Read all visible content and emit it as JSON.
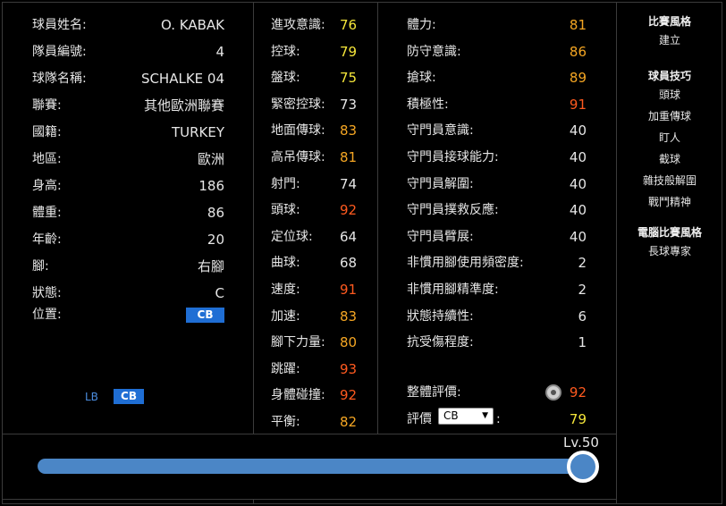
{
  "profile": {
    "rows": [
      {
        "label": "球員姓名:",
        "value": "O. KABAK"
      },
      {
        "label": "隊員編號:",
        "value": "4"
      },
      {
        "label": "球隊名稱:",
        "value": "SCHALKE 04"
      },
      {
        "label": "聯賽:",
        "value": "其他歐洲聯賽"
      },
      {
        "label": "國籍:",
        "value": "TURKEY"
      },
      {
        "label": "地區:",
        "value": "歐洲"
      },
      {
        "label": "身高:",
        "value": "186"
      },
      {
        "label": "體重:",
        "value": "86"
      },
      {
        "label": "年齡:",
        "value": "20"
      },
      {
        "label": "腳:",
        "value": "右腳"
      },
      {
        "label": "狀態:",
        "value": "C"
      }
    ],
    "position_label": "位置:",
    "position_value": "CB",
    "alt_positions": [
      "LB",
      "CB"
    ]
  },
  "skills_left": [
    {
      "label": "進攻意識:",
      "value": "76",
      "color": "#f5e63a"
    },
    {
      "label": "控球:",
      "value": "79",
      "color": "#f5e63a"
    },
    {
      "label": "盤球:",
      "value": "75",
      "color": "#f5e63a"
    },
    {
      "label": "緊密控球:",
      "value": "73",
      "color": "#e6e6e6"
    },
    {
      "label": "地面傳球:",
      "value": "83",
      "color": "#f5a623"
    },
    {
      "label": "高吊傳球:",
      "value": "81",
      "color": "#f5a623"
    },
    {
      "label": "射門:",
      "value": "74",
      "color": "#e6e6e6"
    },
    {
      "label": "頭球:",
      "value": "92",
      "color": "#ff5a1f"
    },
    {
      "label": "定位球:",
      "value": "64",
      "color": "#e6e6e6"
    },
    {
      "label": "曲球:",
      "value": "68",
      "color": "#e6e6e6"
    },
    {
      "label": "速度:",
      "value": "91",
      "color": "#ff5a1f"
    },
    {
      "label": "加速:",
      "value": "83",
      "color": "#f5a623"
    },
    {
      "label": "腳下力量:",
      "value": "80",
      "color": "#f5a623"
    },
    {
      "label": "跳躍:",
      "value": "93",
      "color": "#ff5a1f"
    },
    {
      "label": "身體碰撞:",
      "value": "92",
      "color": "#ff5a1f"
    },
    {
      "label": "平衡:",
      "value": "82",
      "color": "#f5a623"
    }
  ],
  "skills_right": [
    {
      "label": "體力:",
      "value": "81",
      "color": "#f5a623"
    },
    {
      "label": "防守意識:",
      "value": "86",
      "color": "#f5a623"
    },
    {
      "label": "搶球:",
      "value": "89",
      "color": "#f5a623"
    },
    {
      "label": "積極性:",
      "value": "91",
      "color": "#ff5a1f"
    },
    {
      "label": "守門員意識:",
      "value": "40",
      "color": "#e6e6e6"
    },
    {
      "label": "守門員接球能力:",
      "value": "40",
      "color": "#e6e6e6"
    },
    {
      "label": "守門員解圍:",
      "value": "40",
      "color": "#e6e6e6"
    },
    {
      "label": "守門員撲救反應:",
      "value": "40",
      "color": "#e6e6e6"
    },
    {
      "label": "守門員臂展:",
      "value": "40",
      "color": "#e6e6e6"
    },
    {
      "label": "非慣用腳使用頻密度:",
      "value": "2",
      "color": "#e6e6e6"
    },
    {
      "label": "非慣用腳精準度:",
      "value": "2",
      "color": "#e6e6e6"
    },
    {
      "label": "狀態持續性:",
      "value": "6",
      "color": "#e6e6e6"
    },
    {
      "label": "抗受傷程度:",
      "value": "1",
      "color": "#e6e6e6"
    }
  ],
  "overall": {
    "label": "整體評價:",
    "value": "92",
    "color": "#ff5a1f",
    "icon": "rating-medal-icon"
  },
  "evaluation": {
    "label": "評價",
    "selected": "CB",
    "suffix": ":",
    "value": "79",
    "color": "#f5e63a"
  },
  "styles": {
    "play_style_title": "比賽風格",
    "play_style": [
      "建立"
    ],
    "skills_title": "球員技巧",
    "skills": [
      "頭球",
      "加重傳球",
      "盯人",
      "截球",
      "雜技般解圍",
      "戰鬥精神"
    ],
    "ai_style_title": "電腦比賽風格",
    "ai_style": [
      "長球專家"
    ]
  },
  "level": {
    "label": "Lv.50",
    "fraction": 1.0
  }
}
